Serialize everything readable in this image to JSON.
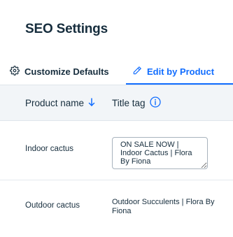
{
  "page": {
    "title": "SEO Settings"
  },
  "tabs": [
    {
      "label": "Customize Defaults",
      "icon": "gear-icon",
      "active": false
    },
    {
      "label": "Edit by Product",
      "icon": "pencil-icon",
      "active": true
    }
  ],
  "table": {
    "columns": [
      {
        "label": "Product name",
        "icon": "arrow-down-icon",
        "sorted": "descending"
      },
      {
        "label": "Title tag",
        "icon": "info-icon"
      }
    ],
    "rows": [
      {
        "name": "Indoor cactus",
        "title_tag": "ON SALE NOW | Indoor Cactus | Flora By Fiona",
        "editing": true
      },
      {
        "name": "Outdoor cactus",
        "title_tag": "Outdoor Succulents | Flora By Fiona",
        "editing": false
      }
    ]
  },
  "colors": {
    "accent": "#116dff",
    "text": "#162d3d",
    "header_bg": "#f2f5f8"
  }
}
